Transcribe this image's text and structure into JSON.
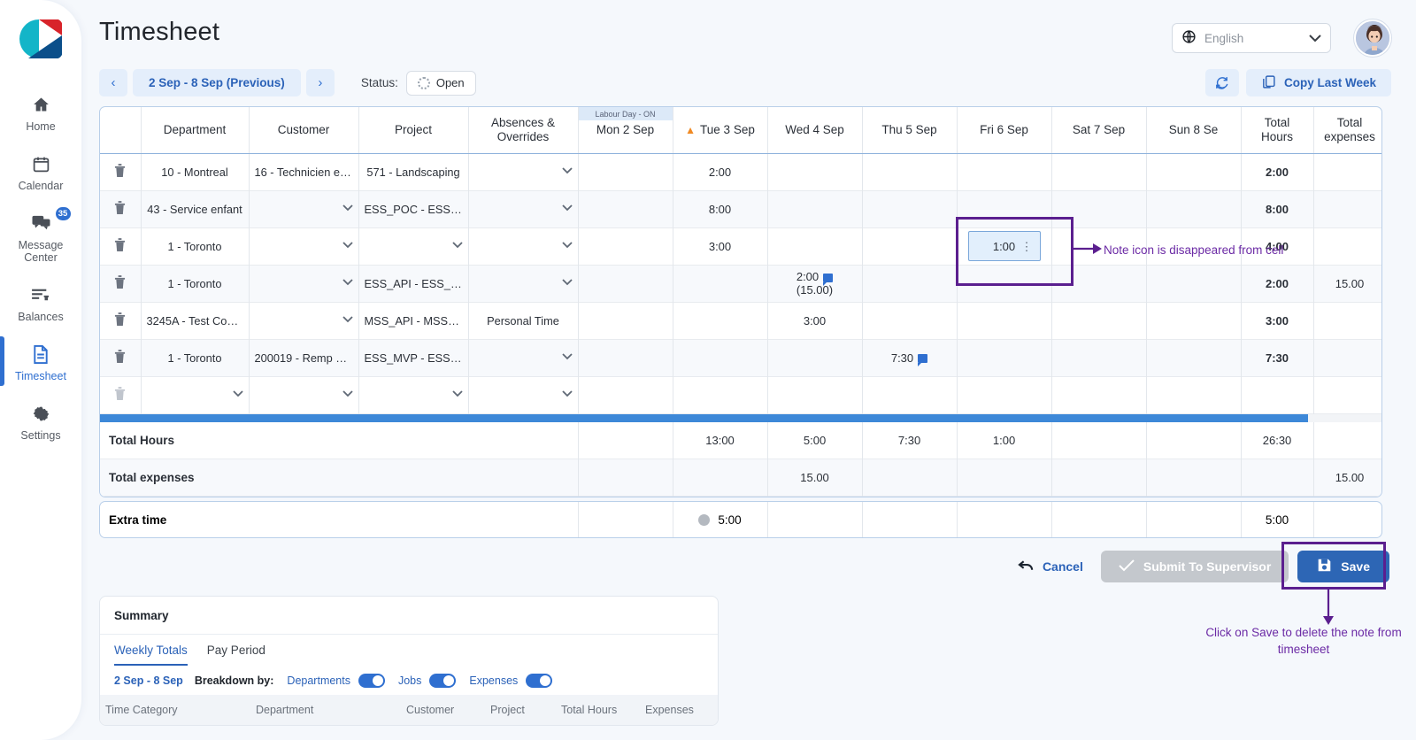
{
  "app": {
    "page_title": "Timesheet",
    "language": "English",
    "globe_icon": "globe-icon",
    "avatar_icon": "user-avatar"
  },
  "sidebar": {
    "items": [
      {
        "label": "Home",
        "icon": "home-icon",
        "active": false
      },
      {
        "label": "Calendar",
        "icon": "calendar-icon",
        "active": false
      },
      {
        "label": "Message Center",
        "icon": "message-icon",
        "active": false,
        "badge": "35"
      },
      {
        "label": "Balances",
        "icon": "balances-icon",
        "active": false
      },
      {
        "label": "Timesheet",
        "icon": "document-icon",
        "active": true
      },
      {
        "label": "Settings",
        "icon": "gear-icon",
        "active": false
      }
    ]
  },
  "toolbar": {
    "prev_arrow": "‹",
    "next_arrow": "›",
    "week_range": "2 Sep - 8 Sep (Previous)",
    "status_label": "Status:",
    "status_value": "Open",
    "refresh_icon": "refresh-icon",
    "copy_last_week": "Copy Last Week"
  },
  "grid": {
    "headers": {
      "department": "Department",
      "customer": "Customer",
      "project": "Project",
      "absences": "Absences & Overrides",
      "total_hours": "Total Hours",
      "total_expenses": "Total expenses"
    },
    "days": [
      {
        "label": "Mon 2 Sep",
        "holiday": "Labour Day - ON",
        "warning": false
      },
      {
        "label": "Tue 3 Sep",
        "holiday": "",
        "warning": true
      },
      {
        "label": "Wed 4 Sep",
        "holiday": "",
        "warning": false
      },
      {
        "label": "Thu 5 Sep",
        "holiday": "",
        "warning": false
      },
      {
        "label": "Fri 6 Sep",
        "holiday": "",
        "warning": false
      },
      {
        "label": "Sat 7 Sep",
        "holiday": "",
        "warning": false
      },
      {
        "label": "Sun 8 Se",
        "holiday": "",
        "warning": false
      }
    ],
    "rows": [
      {
        "department": "10 - Montreal",
        "customer": "16 - Technicien en...",
        "project": "571 - Landscaping",
        "absences": "",
        "days": [
          "",
          "2:00",
          "",
          "",
          "",
          "",
          ""
        ],
        "day_flags": [
          false,
          false,
          false,
          false,
          false,
          false,
          false
        ],
        "day_sub": [
          "",
          "",
          "",
          "",
          "",
          "",
          ""
        ],
        "total_hours": "2:00",
        "total_expenses": ""
      },
      {
        "department": "43 - Service enfant",
        "customer": "",
        "project": "ESS_POC - ESS_P...",
        "absences": "",
        "days": [
          "",
          "8:00",
          "",
          "",
          "",
          "",
          ""
        ],
        "day_flags": [
          false,
          false,
          false,
          false,
          false,
          false,
          false
        ],
        "day_sub": [
          "",
          "",
          "",
          "",
          "",
          "",
          ""
        ],
        "total_hours": "8:00",
        "total_expenses": ""
      },
      {
        "department": "1 - Toronto",
        "customer": "",
        "project": "",
        "absences": "",
        "days": [
          "",
          "3:00",
          "",
          "",
          "1:00",
          "",
          ""
        ],
        "day_flags": [
          false,
          false,
          false,
          false,
          false,
          false,
          false
        ],
        "day_sub": [
          "",
          "",
          "",
          "",
          "",
          "",
          ""
        ],
        "selected_day_index": 4,
        "total_hours": "4:00",
        "total_expenses": ""
      },
      {
        "department": "1 - Toronto",
        "customer": "",
        "project": "ESS_API - ESS_AP...",
        "absences": "",
        "days": [
          "",
          "",
          "2:00",
          "",
          "",
          "",
          ""
        ],
        "day_flags": [
          false,
          false,
          true,
          false,
          false,
          false,
          false
        ],
        "day_sub": [
          "",
          "",
          "(15.00)",
          "",
          "",
          "",
          ""
        ],
        "total_hours": "2:00",
        "total_expenses": "15.00"
      },
      {
        "department": "3245A - Test Com...",
        "customer": "",
        "project": "MSS_API - MSS_A...",
        "absences": "Personal Time",
        "days": [
          "",
          "",
          "3:00",
          "",
          "",
          "",
          ""
        ],
        "day_flags": [
          false,
          false,
          false,
          false,
          false,
          false,
          false
        ],
        "day_sub": [
          "",
          "",
          "",
          "",
          "",
          "",
          ""
        ],
        "total_hours": "3:00",
        "total_expenses": ""
      },
      {
        "department": "1 - Toronto",
        "customer": "200019 - Remp de...",
        "project": "ESS_MVP - ESS_...",
        "absences": "",
        "days": [
          "",
          "",
          "",
          "7:30",
          "",
          "",
          ""
        ],
        "day_flags": [
          false,
          false,
          false,
          true,
          false,
          false,
          false
        ],
        "day_sub": [
          "",
          "",
          "",
          "",
          "",
          "",
          ""
        ],
        "total_hours": "7:30",
        "total_expenses": ""
      },
      {
        "department": "",
        "customer": "",
        "project": "",
        "absences": "",
        "days": [
          "",
          "",
          "",
          "",
          "",
          "",
          ""
        ],
        "day_flags": [
          false,
          false,
          false,
          false,
          false,
          false,
          false
        ],
        "day_sub": [
          "",
          "",
          "",
          "",
          "",
          "",
          ""
        ],
        "total_hours": "",
        "total_expenses": "",
        "empty": true
      }
    ],
    "total_hours_row": {
      "label": "Total Hours",
      "days": [
        "",
        "13:00",
        "5:00",
        "7:30",
        "1:00",
        "",
        ""
      ],
      "total": "26:30",
      "expenses": ""
    },
    "total_expenses_row": {
      "label": "Total expenses",
      "days": [
        "",
        "",
        "15.00",
        "",
        "",
        "",
        ""
      ],
      "total": "",
      "expenses": "15.00"
    }
  },
  "extra_time": {
    "label": "Extra time",
    "days": [
      "",
      "5:00",
      "",
      "",
      "",
      "",
      ""
    ],
    "total": "5:00",
    "expenses": ""
  },
  "actions": {
    "cancel": "Cancel",
    "submit": "Submit To Supervisor",
    "save": "Save"
  },
  "summary": {
    "title": "Summary",
    "tabs": [
      {
        "label": "Weekly Totals",
        "active": true
      },
      {
        "label": "Pay Period",
        "active": false
      }
    ],
    "range": "2 Sep - 8 Sep",
    "breakdown_label": "Breakdown by:",
    "toggles": [
      {
        "label": "Departments",
        "on": true
      },
      {
        "label": "Jobs",
        "on": true
      },
      {
        "label": "Expenses",
        "on": true
      }
    ],
    "columns": [
      "Time Category",
      "Department",
      "Customer",
      "Project",
      "Total Hours",
      "Expenses"
    ]
  },
  "annotations": {
    "note_cell": "Note icon is disappeared from cell",
    "save_hint": "Click on Save to delete the note from timesheet",
    "color": "#5b1f8f"
  }
}
